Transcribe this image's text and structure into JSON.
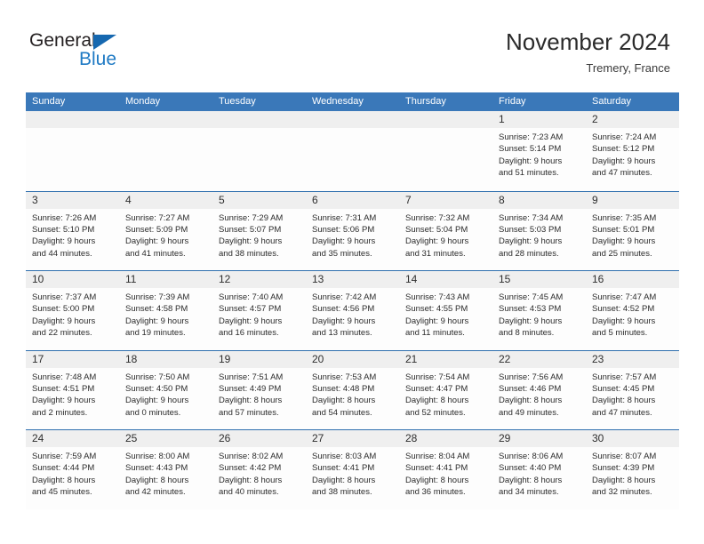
{
  "brand": {
    "logo_text_1": "General",
    "logo_text_2": "Blue",
    "triangle_icon": "triangle-icon",
    "accent_color": "#1f7ac4",
    "header_color": "#3a78b9"
  },
  "header": {
    "title": "November 2024",
    "subtitle": "Tremery, France"
  },
  "calendar": {
    "weekday_headers": [
      "Sunday",
      "Monday",
      "Tuesday",
      "Wednesday",
      "Thursday",
      "Friday",
      "Saturday"
    ],
    "weeks": [
      [
        {
          "day": "",
          "empty": true
        },
        {
          "day": "",
          "empty": true
        },
        {
          "day": "",
          "empty": true
        },
        {
          "day": "",
          "empty": true
        },
        {
          "day": "",
          "empty": true
        },
        {
          "day": "1",
          "sunrise": "Sunrise: 7:23 AM",
          "sunset": "Sunset: 5:14 PM",
          "daylight_1": "Daylight: 9 hours",
          "daylight_2": "and 51 minutes."
        },
        {
          "day": "2",
          "sunrise": "Sunrise: 7:24 AM",
          "sunset": "Sunset: 5:12 PM",
          "daylight_1": "Daylight: 9 hours",
          "daylight_2": "and 47 minutes."
        }
      ],
      [
        {
          "day": "3",
          "sunrise": "Sunrise: 7:26 AM",
          "sunset": "Sunset: 5:10 PM",
          "daylight_1": "Daylight: 9 hours",
          "daylight_2": "and 44 minutes."
        },
        {
          "day": "4",
          "sunrise": "Sunrise: 7:27 AM",
          "sunset": "Sunset: 5:09 PM",
          "daylight_1": "Daylight: 9 hours",
          "daylight_2": "and 41 minutes."
        },
        {
          "day": "5",
          "sunrise": "Sunrise: 7:29 AM",
          "sunset": "Sunset: 5:07 PM",
          "daylight_1": "Daylight: 9 hours",
          "daylight_2": "and 38 minutes."
        },
        {
          "day": "6",
          "sunrise": "Sunrise: 7:31 AM",
          "sunset": "Sunset: 5:06 PM",
          "daylight_1": "Daylight: 9 hours",
          "daylight_2": "and 35 minutes."
        },
        {
          "day": "7",
          "sunrise": "Sunrise: 7:32 AM",
          "sunset": "Sunset: 5:04 PM",
          "daylight_1": "Daylight: 9 hours",
          "daylight_2": "and 31 minutes."
        },
        {
          "day": "8",
          "sunrise": "Sunrise: 7:34 AM",
          "sunset": "Sunset: 5:03 PM",
          "daylight_1": "Daylight: 9 hours",
          "daylight_2": "and 28 minutes."
        },
        {
          "day": "9",
          "sunrise": "Sunrise: 7:35 AM",
          "sunset": "Sunset: 5:01 PM",
          "daylight_1": "Daylight: 9 hours",
          "daylight_2": "and 25 minutes."
        }
      ],
      [
        {
          "day": "10",
          "sunrise": "Sunrise: 7:37 AM",
          "sunset": "Sunset: 5:00 PM",
          "daylight_1": "Daylight: 9 hours",
          "daylight_2": "and 22 minutes."
        },
        {
          "day": "11",
          "sunrise": "Sunrise: 7:39 AM",
          "sunset": "Sunset: 4:58 PM",
          "daylight_1": "Daylight: 9 hours",
          "daylight_2": "and 19 minutes."
        },
        {
          "day": "12",
          "sunrise": "Sunrise: 7:40 AM",
          "sunset": "Sunset: 4:57 PM",
          "daylight_1": "Daylight: 9 hours",
          "daylight_2": "and 16 minutes."
        },
        {
          "day": "13",
          "sunrise": "Sunrise: 7:42 AM",
          "sunset": "Sunset: 4:56 PM",
          "daylight_1": "Daylight: 9 hours",
          "daylight_2": "and 13 minutes."
        },
        {
          "day": "14",
          "sunrise": "Sunrise: 7:43 AM",
          "sunset": "Sunset: 4:55 PM",
          "daylight_1": "Daylight: 9 hours",
          "daylight_2": "and 11 minutes."
        },
        {
          "day": "15",
          "sunrise": "Sunrise: 7:45 AM",
          "sunset": "Sunset: 4:53 PM",
          "daylight_1": "Daylight: 9 hours",
          "daylight_2": "and 8 minutes."
        },
        {
          "day": "16",
          "sunrise": "Sunrise: 7:47 AM",
          "sunset": "Sunset: 4:52 PM",
          "daylight_1": "Daylight: 9 hours",
          "daylight_2": "and 5 minutes."
        }
      ],
      [
        {
          "day": "17",
          "sunrise": "Sunrise: 7:48 AM",
          "sunset": "Sunset: 4:51 PM",
          "daylight_1": "Daylight: 9 hours",
          "daylight_2": "and 2 minutes."
        },
        {
          "day": "18",
          "sunrise": "Sunrise: 7:50 AM",
          "sunset": "Sunset: 4:50 PM",
          "daylight_1": "Daylight: 9 hours",
          "daylight_2": "and 0 minutes."
        },
        {
          "day": "19",
          "sunrise": "Sunrise: 7:51 AM",
          "sunset": "Sunset: 4:49 PM",
          "daylight_1": "Daylight: 8 hours",
          "daylight_2": "and 57 minutes."
        },
        {
          "day": "20",
          "sunrise": "Sunrise: 7:53 AM",
          "sunset": "Sunset: 4:48 PM",
          "daylight_1": "Daylight: 8 hours",
          "daylight_2": "and 54 minutes."
        },
        {
          "day": "21",
          "sunrise": "Sunrise: 7:54 AM",
          "sunset": "Sunset: 4:47 PM",
          "daylight_1": "Daylight: 8 hours",
          "daylight_2": "and 52 minutes."
        },
        {
          "day": "22",
          "sunrise": "Sunrise: 7:56 AM",
          "sunset": "Sunset: 4:46 PM",
          "daylight_1": "Daylight: 8 hours",
          "daylight_2": "and 49 minutes."
        },
        {
          "day": "23",
          "sunrise": "Sunrise: 7:57 AM",
          "sunset": "Sunset: 4:45 PM",
          "daylight_1": "Daylight: 8 hours",
          "daylight_2": "and 47 minutes."
        }
      ],
      [
        {
          "day": "24",
          "sunrise": "Sunrise: 7:59 AM",
          "sunset": "Sunset: 4:44 PM",
          "daylight_1": "Daylight: 8 hours",
          "daylight_2": "and 45 minutes."
        },
        {
          "day": "25",
          "sunrise": "Sunrise: 8:00 AM",
          "sunset": "Sunset: 4:43 PM",
          "daylight_1": "Daylight: 8 hours",
          "daylight_2": "and 42 minutes."
        },
        {
          "day": "26",
          "sunrise": "Sunrise: 8:02 AM",
          "sunset": "Sunset: 4:42 PM",
          "daylight_1": "Daylight: 8 hours",
          "daylight_2": "and 40 minutes."
        },
        {
          "day": "27",
          "sunrise": "Sunrise: 8:03 AM",
          "sunset": "Sunset: 4:41 PM",
          "daylight_1": "Daylight: 8 hours",
          "daylight_2": "and 38 minutes."
        },
        {
          "day": "28",
          "sunrise": "Sunrise: 8:04 AM",
          "sunset": "Sunset: 4:41 PM",
          "daylight_1": "Daylight: 8 hours",
          "daylight_2": "and 36 minutes."
        },
        {
          "day": "29",
          "sunrise": "Sunrise: 8:06 AM",
          "sunset": "Sunset: 4:40 PM",
          "daylight_1": "Daylight: 8 hours",
          "daylight_2": "and 34 minutes."
        },
        {
          "day": "30",
          "sunrise": "Sunrise: 8:07 AM",
          "sunset": "Sunset: 4:39 PM",
          "daylight_1": "Daylight: 8 hours",
          "daylight_2": "and 32 minutes."
        }
      ]
    ]
  }
}
